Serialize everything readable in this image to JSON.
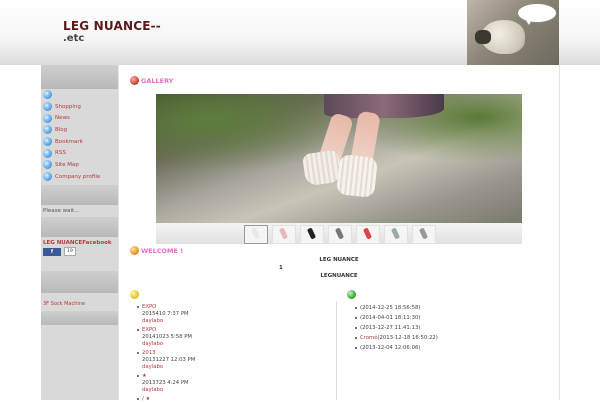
{
  "header": {
    "title": "LEG NUANCE--",
    "subtitle": ".etc"
  },
  "sidebar": {
    "nav_items": [
      {
        "label": "",
        "icon": "arrow-icon"
      },
      {
        "label": "Shopping",
        "icon": "arrow-icon"
      },
      {
        "label": "News",
        "icon": "arrow-icon"
      },
      {
        "label": "Blog",
        "icon": "arrow-icon"
      },
      {
        "label": "Bookmark",
        "icon": "arrow-icon"
      },
      {
        "label": "RSS",
        "icon": "arrow-icon"
      },
      {
        "label": "Site Map",
        "icon": "arrow-icon"
      },
      {
        "label": "Company profile",
        "icon": "arrow-icon"
      }
    ],
    "please_wait": "Please wait...",
    "facebook_title": "LEG NUANCEFacebook",
    "facebook_button": "f",
    "facebook_count": "19",
    "sock_machine": "3F Sock Machine"
  },
  "gallery": {
    "title": "GALLERY",
    "thumbnail_count": 8
  },
  "welcome": {
    "title": "WELCOME !",
    "line1": "LEG NUANCE",
    "line2": "1",
    "line3": "LEGNUANCE"
  },
  "blog": {
    "entries": [
      {
        "title": "EXPO",
        "meta": "2015410 7:37 PM",
        "author": "daylabo"
      },
      {
        "title": "EXPO",
        "meta": "20141023 5:58 PM",
        "author": "daylabo"
      },
      {
        "title": "2013",
        "meta": "20131227 12:03 PM",
        "author": "daylabo"
      },
      {
        "title": "★",
        "meta": "2013723 4:24 PM",
        "author": "daylabo"
      },
      {
        "title": "/ ★",
        "meta": "",
        "author": ""
      }
    ]
  },
  "updates": {
    "items": [
      {
        "link": "",
        "date": "(2014-12-25 18:56:58)"
      },
      {
        "link": "",
        "date": "(2014-04-01 18:11:30)"
      },
      {
        "link": "",
        "date": "(2013-12-27 11:41:13)"
      },
      {
        "link": "Cromé",
        "date": "(2013-12-18 16:50:22)"
      },
      {
        "link": "",
        "date": "(2013-12-04 12:06:06)"
      }
    ]
  },
  "colors": {
    "accent_pink": "#e070c0",
    "link_red": "#b43a3a",
    "title_dark": "#5a1a1a",
    "sidebar_gray": "#d9d9d9"
  }
}
